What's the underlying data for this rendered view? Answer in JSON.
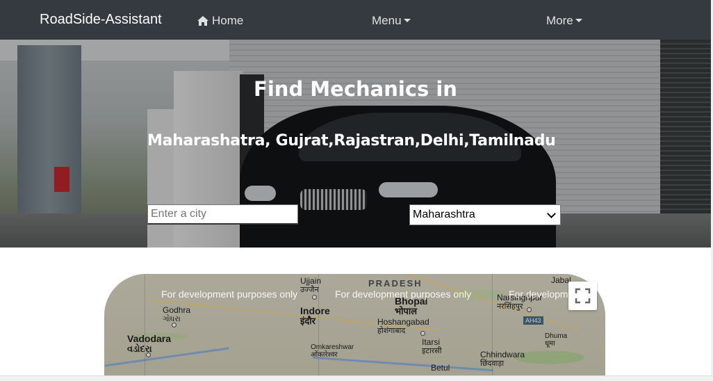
{
  "navbar": {
    "brand": "RoadSide-Assistant",
    "home_label": "Home",
    "menu_label": "Menu",
    "more_label": "More"
  },
  "hero": {
    "title": "Find Mechanics in",
    "subtitle": "Maharashatra, Gujrat,Rajastran,Delhi,Tamilnadu",
    "city_placeholder": "Enter a city",
    "state_selected": "Maharashtra"
  },
  "map": {
    "watermark": "For development purposes only",
    "watermark_partial_left": "only",
    "watermark_partial_right": "For developm",
    "region_label": "PRADESH",
    "highway_shield": "AH43",
    "cities": [
      {
        "en": "Ujjain",
        "hi": "उज्जैन"
      },
      {
        "en": "Indore",
        "hi": "इंदौर"
      },
      {
        "en": "Bhopal",
        "hi": "भोपाल"
      },
      {
        "en": "Vadodara",
        "hi": "વડોદરા"
      },
      {
        "en": "Godhra",
        "hi": "ગોધરા"
      },
      {
        "en": "Hoshangabad",
        "hi": "होशंगाबाद"
      },
      {
        "en": "Narsinghpur",
        "hi": "नरसिंहपुर"
      },
      {
        "en": "Chhindwara",
        "hi": "छिंदवाड़ा"
      },
      {
        "en": "Itarsi",
        "hi": "इटारसी"
      },
      {
        "en": "Omkareshwar",
        "hi": "ओंकारेश्वर"
      },
      {
        "en": "Betul",
        "hi": ""
      },
      {
        "en": "Dhuma",
        "hi": "धूमा"
      },
      {
        "en": "Jabal",
        "hi": ""
      }
    ]
  },
  "icons": {
    "home": "home-icon",
    "fullscreen": "fullscreen-icon"
  },
  "colors": {
    "navbar_bg": "#343a40",
    "hero_text": "#ffffff"
  }
}
